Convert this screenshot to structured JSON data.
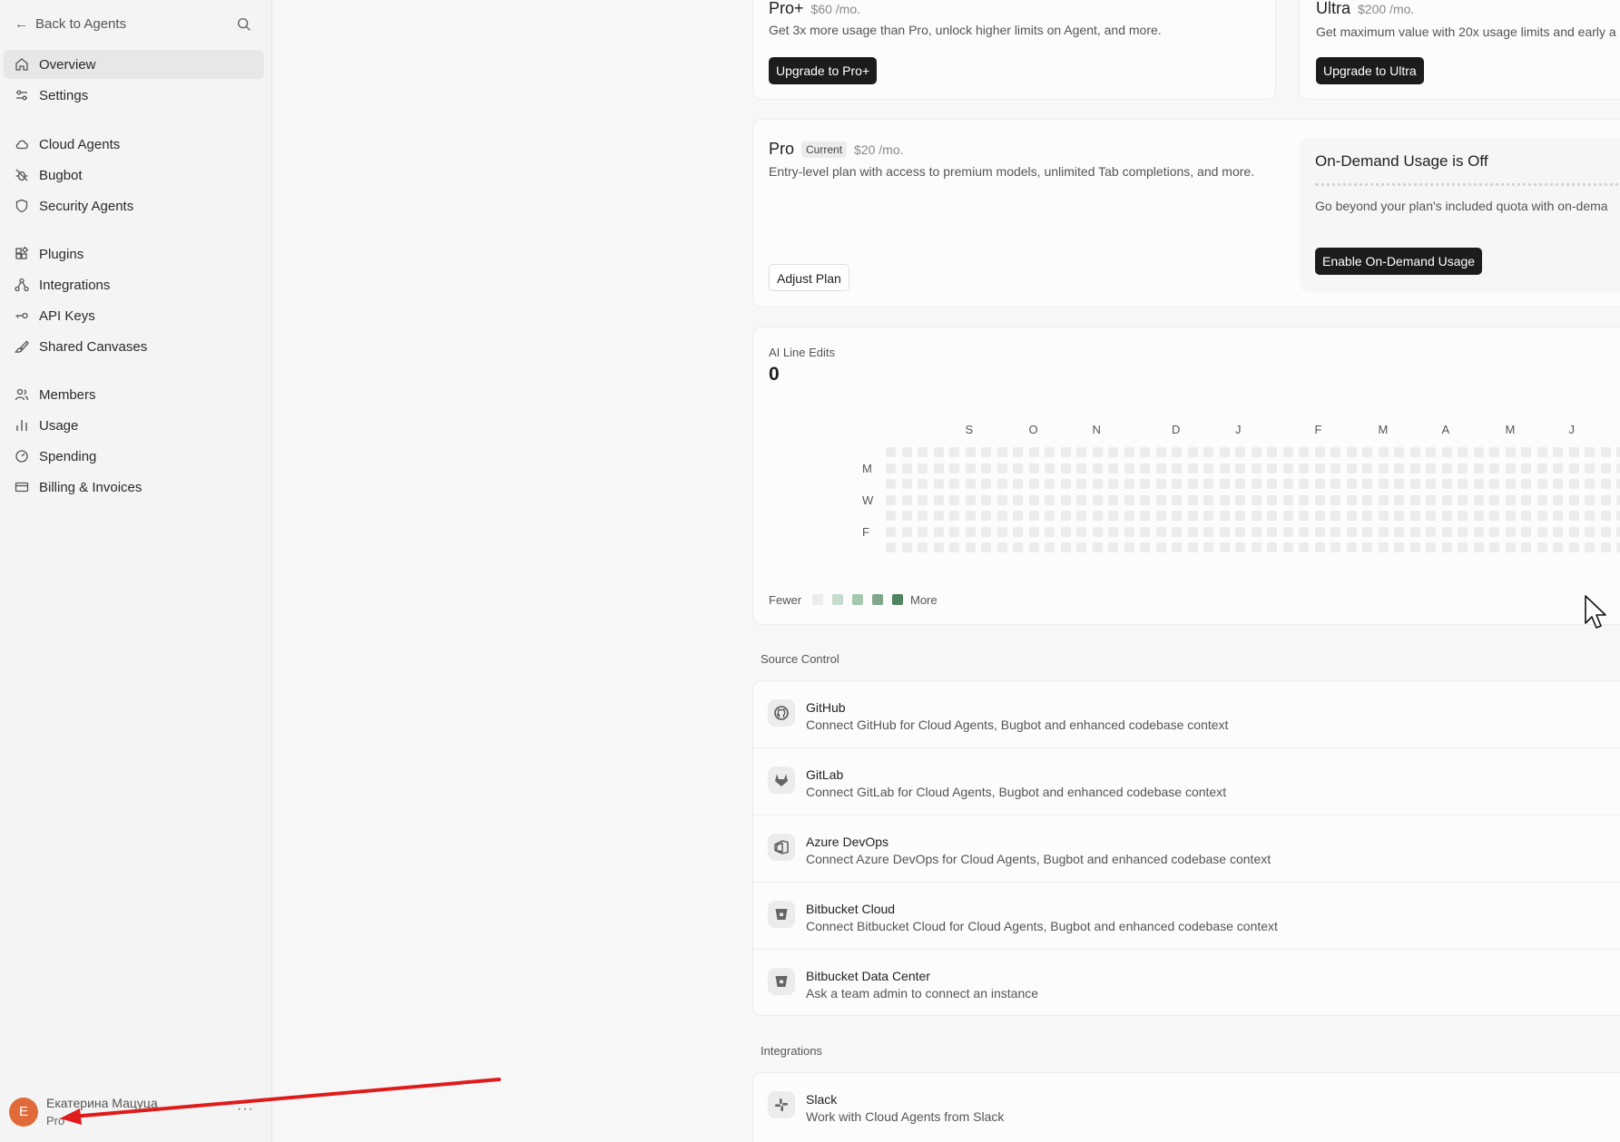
{
  "sidebar": {
    "back_label": "Back to Agents",
    "items": [
      {
        "label": "Overview",
        "icon": "home-icon"
      },
      {
        "label": "Settings",
        "icon": "sliders-icon"
      },
      {
        "label": "Cloud Agents",
        "icon": "cloud-icon"
      },
      {
        "label": "Bugbot",
        "icon": "bug-icon"
      },
      {
        "label": "Security Agents",
        "icon": "shield-icon"
      },
      {
        "label": "Plugins",
        "icon": "plugin-icon"
      },
      {
        "label": "Integrations",
        "icon": "integrations-icon"
      },
      {
        "label": "API Keys",
        "icon": "key-icon"
      },
      {
        "label": "Shared Canvases",
        "icon": "brush-icon"
      },
      {
        "label": "Members",
        "icon": "users-icon"
      },
      {
        "label": "Usage",
        "icon": "bar-chart-icon"
      },
      {
        "label": "Spending",
        "icon": "gauge-icon"
      },
      {
        "label": "Billing & Invoices",
        "icon": "card-icon"
      }
    ],
    "user": {
      "initial": "E",
      "name": "Екатерина Мацуца",
      "plan": "Pro",
      "more": "···"
    }
  },
  "plans": {
    "pro_plus": {
      "name": "Pro+",
      "price": "$60 /mo.",
      "desc": "Get 3x more usage than Pro, unlock higher limits on Agent, and more.",
      "button": "Upgrade to Pro+"
    },
    "ultra": {
      "name": "Ultra",
      "price": "$200 /mo.",
      "desc": "Get maximum value with 20x usage limits and early a",
      "button": "Upgrade to Ultra"
    },
    "pro": {
      "name": "Pro",
      "badge": "Current",
      "price": "$20 /mo.",
      "desc": "Entry-level plan with access to premium models, unlimited Tab completions, and more.",
      "button": "Adjust Plan"
    },
    "on_demand": {
      "title": "On-Demand Usage is Off",
      "desc": "Go beyond your plan's included quota with on-dema",
      "button": "Enable On-Demand Usage"
    }
  },
  "activity": {
    "title": "AI Line Edits",
    "value": "0",
    "months": [
      "S",
      "O",
      "N",
      "D",
      "J",
      "F",
      "M",
      "A",
      "M",
      "J"
    ],
    "days": [
      "M",
      "W",
      "F"
    ],
    "legend_fewer": "Fewer",
    "legend_more": "More",
    "legend_colors": [
      "#ececec",
      "#c6dccc",
      "#a6c6ae",
      "#7fa98a",
      "#4f8460"
    ]
  },
  "source_control": {
    "label": "Source Control",
    "items": [
      {
        "title": "GitHub",
        "desc": "Connect GitHub for Cloud Agents, Bugbot and enhanced codebase context",
        "icon": "github-icon"
      },
      {
        "title": "GitLab",
        "desc": "Connect GitLab for Cloud Agents, Bugbot and enhanced codebase context",
        "icon": "gitlab-icon"
      },
      {
        "title": "Azure DevOps",
        "desc": "Connect Azure DevOps for Cloud Agents, Bugbot and enhanced codebase context",
        "icon": "azure-devops-icon"
      },
      {
        "title": "Bitbucket Cloud",
        "desc": "Connect Bitbucket Cloud for Cloud Agents, Bugbot and enhanced codebase context",
        "icon": "bitbucket-icon"
      },
      {
        "title": "Bitbucket Data Center",
        "desc": "Ask a team admin to connect an instance",
        "icon": "bitbucket-icon"
      }
    ]
  },
  "integrations": {
    "label": "Integrations",
    "items": [
      {
        "title": "Slack",
        "desc": "Work with Cloud Agents from Slack",
        "icon": "slack-icon"
      }
    ]
  }
}
